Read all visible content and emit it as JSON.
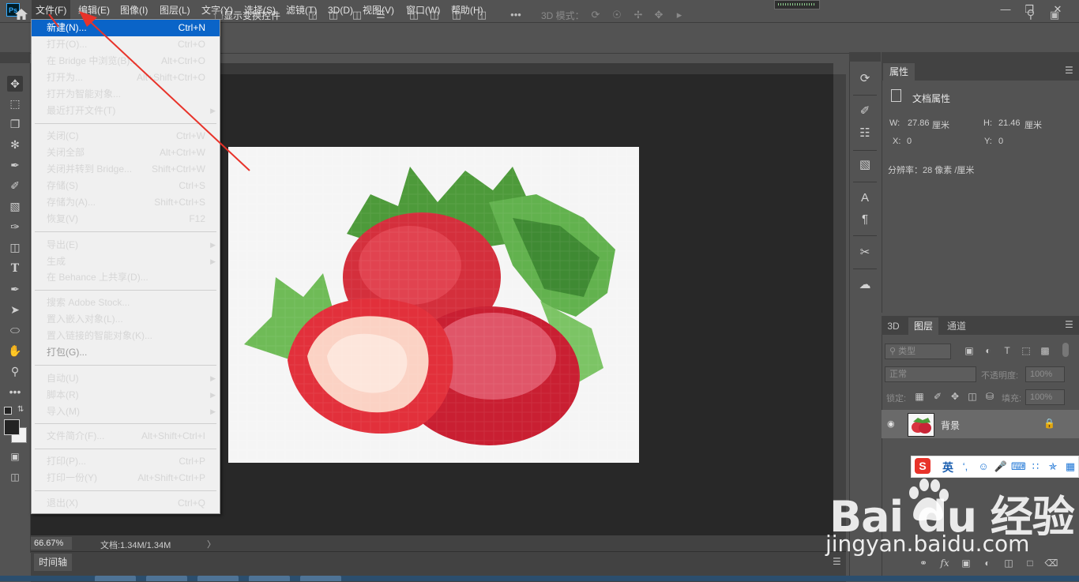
{
  "app": {
    "logo": "Ps"
  },
  "menubar": {
    "items": [
      "文件(F)",
      "编辑(E)",
      "图像(I)",
      "图层(L)",
      "文字(Y)",
      "选择(S)",
      "滤镜(T)",
      "3D(D)",
      "视图(V)",
      "窗口(W)",
      "帮助(H)"
    ]
  },
  "options": {
    "show_transform_controls": "显示变换控件",
    "mode_3d": "3D 模式："
  },
  "file_menu": {
    "items": [
      {
        "label": "新建(N)...",
        "shortcut": "Ctrl+N"
      },
      {
        "label": "打开(O)...",
        "shortcut": "Ctrl+O"
      },
      {
        "label": "在 Bridge 中浏览(B)...",
        "shortcut": "Alt+Ctrl+O"
      },
      {
        "label": "打开为...",
        "shortcut": "Alt+Shift+Ctrl+O"
      },
      {
        "label": "打开为智能对象...",
        "shortcut": ""
      },
      {
        "label": "最近打开文件(T)",
        "shortcut": ""
      },
      {
        "label": "关闭(C)",
        "shortcut": "Ctrl+W"
      },
      {
        "label": "关闭全部",
        "shortcut": "Alt+Ctrl+W"
      },
      {
        "label": "关闭并转到 Bridge...",
        "shortcut": "Shift+Ctrl+W"
      },
      {
        "label": "存储(S)",
        "shortcut": "Ctrl+S"
      },
      {
        "label": "存储为(A)...",
        "shortcut": "Shift+Ctrl+S"
      },
      {
        "label": "恢复(V)",
        "shortcut": "F12"
      },
      {
        "label": "导出(E)",
        "shortcut": ""
      },
      {
        "label": "生成",
        "shortcut": ""
      },
      {
        "label": "在 Behance 上共享(D)...",
        "shortcut": ""
      },
      {
        "label": "搜索 Adobe Stock...",
        "shortcut": ""
      },
      {
        "label": "置入嵌入对象(L)...",
        "shortcut": ""
      },
      {
        "label": "置入链接的智能对象(K)...",
        "shortcut": ""
      },
      {
        "label": "打包(G)...",
        "shortcut": ""
      },
      {
        "label": "自动(U)",
        "shortcut": ""
      },
      {
        "label": "脚本(R)",
        "shortcut": ""
      },
      {
        "label": "导入(M)",
        "shortcut": ""
      },
      {
        "label": "文件简介(F)...",
        "shortcut": "Alt+Shift+Ctrl+I"
      },
      {
        "label": "打印(P)...",
        "shortcut": "Ctrl+P"
      },
      {
        "label": "打印一份(Y)",
        "shortcut": "Alt+Shift+Ctrl+P"
      },
      {
        "label": "退出(X)",
        "shortcut": "Ctrl+Q"
      }
    ]
  },
  "status": {
    "zoom": "66.67%",
    "doc_size": "文档:1.34M/1.34M",
    "arrow": "〉"
  },
  "timeline": {
    "tab": "时间轴"
  },
  "properties": {
    "tab": "属性",
    "section_title": "文档属性",
    "w_label": "W:",
    "w_value": "27.86",
    "w_unit": "厘米",
    "h_label": "H:",
    "h_value": "21.46",
    "h_unit": "厘米",
    "x_label": "X:",
    "x_value": "0",
    "y_label": "Y:",
    "y_value": "0",
    "resolution": "分辨率：28 像素 /厘米"
  },
  "layers": {
    "tabs": [
      "3D",
      "图层",
      "通道"
    ],
    "filter_placeholder": "类型",
    "blend_mode": "正常",
    "opacity_label": "不透明度:",
    "opacity_value": "100%",
    "lock_label": "锁定:",
    "fill_label": "填充:",
    "fill_value": "100%",
    "layer_name": "背景"
  },
  "ime": {
    "lang": "英",
    "logo": "S"
  },
  "watermark": {
    "logo": "Bai  du 经验",
    "url": "jingyan.baidu.com"
  },
  "colors": {
    "highlight": "#0a64c8",
    "arrow": "#e8332a",
    "ui_bg": "#535353",
    "canvas_bg": "#282828"
  }
}
